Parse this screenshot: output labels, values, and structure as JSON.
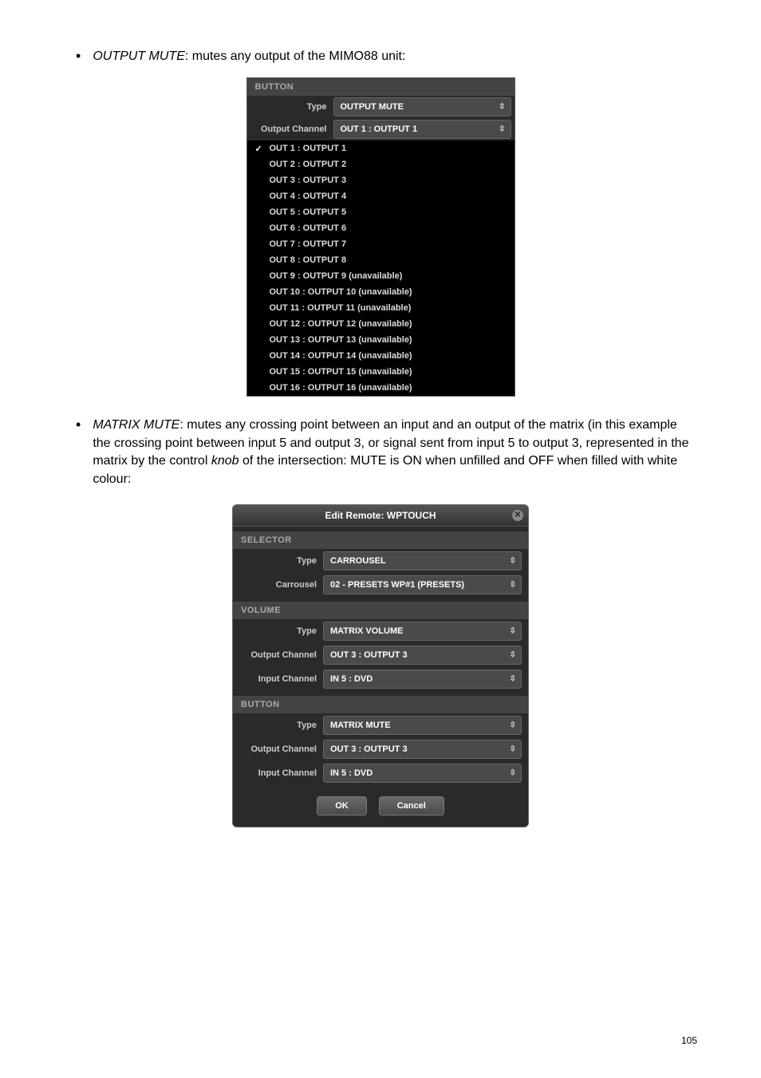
{
  "body": {
    "bullet1": {
      "term": "OUTPUT MUTE",
      "desc": ": mutes any output of the MIMO88 unit:"
    },
    "bullet2": {
      "term": "MATRIX MUTE",
      "desc_lead": ": mutes any crossing point between an input and an output of the matrix (in this example the crossing point between input 5 and output 3, or signal sent from input 5 to output 3, represented in the matrix by the control ",
      "knob": "knob",
      "desc_tail": " of the intersection: MUTE is ON when unfilled and OFF when filled with white colour:"
    }
  },
  "panel1": {
    "section": "BUTTON",
    "type_label": "Type",
    "type_value": "OUTPUT MUTE",
    "outch_label": "Output Channel",
    "outch_value": "OUT 1 : OUTPUT 1",
    "options": [
      "OUT 1 : OUTPUT 1",
      "OUT 2 : OUTPUT 2",
      "OUT 3 : OUTPUT 3",
      "OUT 4 : OUTPUT 4",
      "OUT 5 : OUTPUT 5",
      "OUT 6 : OUTPUT 6",
      "OUT 7 : OUTPUT 7",
      "OUT 8 : OUTPUT 8",
      "OUT 9 : OUTPUT 9 (unavailable)",
      "OUT 10 : OUTPUT 10 (unavailable)",
      "OUT 11 : OUTPUT 11 (unavailable)",
      "OUT 12 : OUTPUT 12 (unavailable)",
      "OUT 13 : OUTPUT 13 (unavailable)",
      "OUT 14 : OUTPUT 14 (unavailable)",
      "OUT 15 : OUTPUT 15 (unavailable)",
      "OUT 16 : OUTPUT 16 (unavailable)"
    ]
  },
  "dialog": {
    "title": "Edit Remote: WPTOUCH",
    "selector": {
      "header": "SELECTOR",
      "type_label": "Type",
      "type_value": "CARROUSEL",
      "carr_label": "Carrousel",
      "carr_value": "02 - PRESETS WP#1 (PRESETS)"
    },
    "volume": {
      "header": "VOLUME",
      "type_label": "Type",
      "type_value": "MATRIX VOLUME",
      "outch_label": "Output Channel",
      "outch_value": "OUT 3 : OUTPUT 3",
      "inch_label": "Input Channel",
      "inch_value": "IN 5 : DVD"
    },
    "button": {
      "header": "BUTTON",
      "type_label": "Type",
      "type_value": "MATRIX MUTE",
      "outch_label": "Output Channel",
      "outch_value": "OUT 3 : OUTPUT 3",
      "inch_label": "Input Channel",
      "inch_value": "IN 5 : DVD"
    },
    "ok": "OK",
    "cancel": "Cancel"
  },
  "page_number": "105"
}
